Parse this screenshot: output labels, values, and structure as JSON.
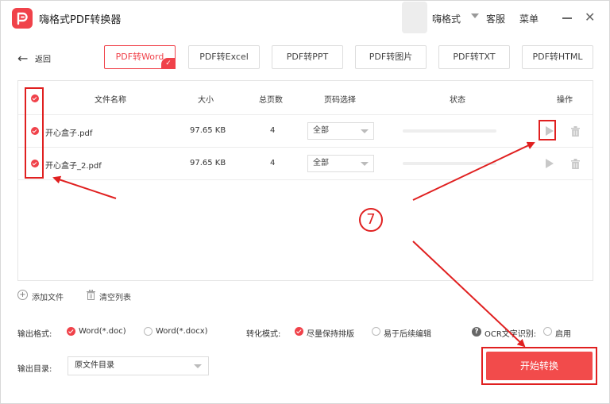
{
  "app": {
    "title": "嗨格式PDF转换器",
    "username": "嗨格式",
    "service": "客服",
    "menu": "菜单",
    "minimize": "—",
    "close": "✕",
    "brand_color": "#f0424a"
  },
  "nav": {
    "back": "返回"
  },
  "tabs": [
    {
      "label": "PDF转Word",
      "active": true
    },
    {
      "label": "PDF转Excel",
      "active": false
    },
    {
      "label": "PDF转PPT",
      "active": false
    },
    {
      "label": "PDF转图片",
      "active": false
    },
    {
      "label": "PDF转TXT",
      "active": false
    },
    {
      "label": "PDF转HTML",
      "active": false
    }
  ],
  "table": {
    "headers": {
      "name": "文件名称",
      "size": "大小",
      "pages": "总页数",
      "page_select": "页码选择",
      "status": "状态",
      "actions": "操作"
    },
    "rows": [
      {
        "name": "开心盒子.pdf",
        "size": "97.65 KB",
        "pages": "4",
        "page_select": "全部",
        "progress": 0.0
      },
      {
        "name": "开心盒子_2.pdf",
        "size": "97.65 KB",
        "pages": "4",
        "page_select": "全部",
        "progress": 0.0
      }
    ]
  },
  "footer": {
    "add_file": "添加文件",
    "clear_list": "清空列表"
  },
  "settings": {
    "output_format_label": "输出格式:",
    "format_options": [
      "Word(*.doc)",
      "Word(*.docx)"
    ],
    "format_selected": "Word(*.doc)",
    "convert_mode_label": "转化模式:",
    "mode_options": [
      "尽量保持排版",
      "易于后续编辑"
    ],
    "mode_selected": "尽量保持排版",
    "ocr_label": "OCR文字识别:",
    "ocr_option": "启用",
    "output_dir_label": "输出目录:",
    "output_dir_value": "原文件目录"
  },
  "start_button": "开始转换",
  "annotation": {
    "step": "⑦"
  }
}
